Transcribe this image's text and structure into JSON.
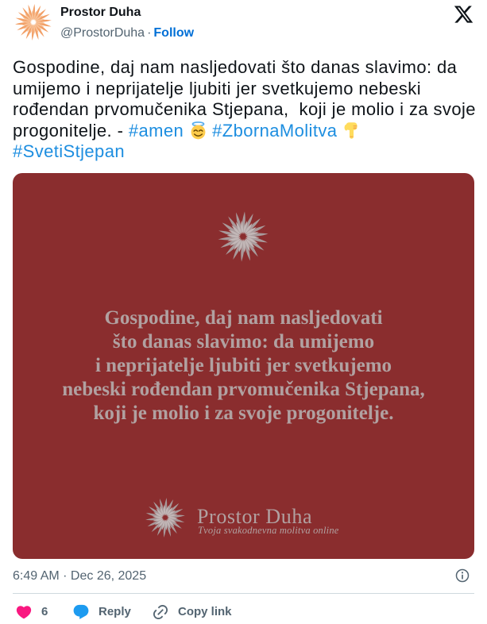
{
  "author": {
    "name": "Prostor Duha",
    "handle": "@ProstorDuha",
    "separator": "·",
    "follow_label": "Follow",
    "avatar_icon": "starburst-logo-icon"
  },
  "platform_icon": "x-logo-icon",
  "tweet": {
    "text_lines": [
      "Gospodine, daj nam nasljedovati što danas slavimo: da",
      "umijemo i neprijatelje ljubiti jer svetkujemo nebeski",
      "rođendan prvomučenika Stjepana,  koji je molio i za svoje",
      "progonitelje. -"
    ],
    "hashtags": [
      "#amen",
      "#ZbornaMolitva",
      "#SvetiStjepan"
    ],
    "emojis": [
      "smiling-face-with-halo-icon",
      "backhand-index-pointing-down-icon"
    ]
  },
  "media": {
    "icon": "starburst-logo-icon",
    "quote_lines": [
      "Gospodine, daj nam nasljedovati",
      "što danas slavimo: da umijemo",
      "i neprijatelje ljubiti jer svetkujemo",
      "nebeski rođendan prvomučenika Stjepana,",
      "koji je molio i za svoje progonitelje."
    ],
    "brand_name": "Prostor Duha",
    "brand_tagline": "Tvoja svakodnevna molitva online"
  },
  "meta": {
    "timestamp": "6:49 AM · Dec 26, 2025",
    "info_icon": "info-icon"
  },
  "actions": {
    "like": {
      "icon": "heart-icon",
      "count": "6"
    },
    "reply": {
      "icon": "reply-bubble-icon",
      "label": "Reply"
    },
    "copy_link": {
      "icon": "link-icon",
      "label": "Copy link"
    }
  },
  "colors": {
    "text": "#0f1419",
    "muted": "#536471",
    "link": "#006fd6",
    "hashtag": "#1d8ee0",
    "card": "#8a2d2e",
    "card_text": "#b1a1a1",
    "line": "#cfd9de",
    "like": "#f91880",
    "reply": "#1d9bf0",
    "avatar_petal_outer": "#f2a067",
    "avatar_petal_inner": "#f8c196",
    "card_petal_outer": "#a89a9b",
    "card_petal_inner": "#c2b7b7"
  }
}
